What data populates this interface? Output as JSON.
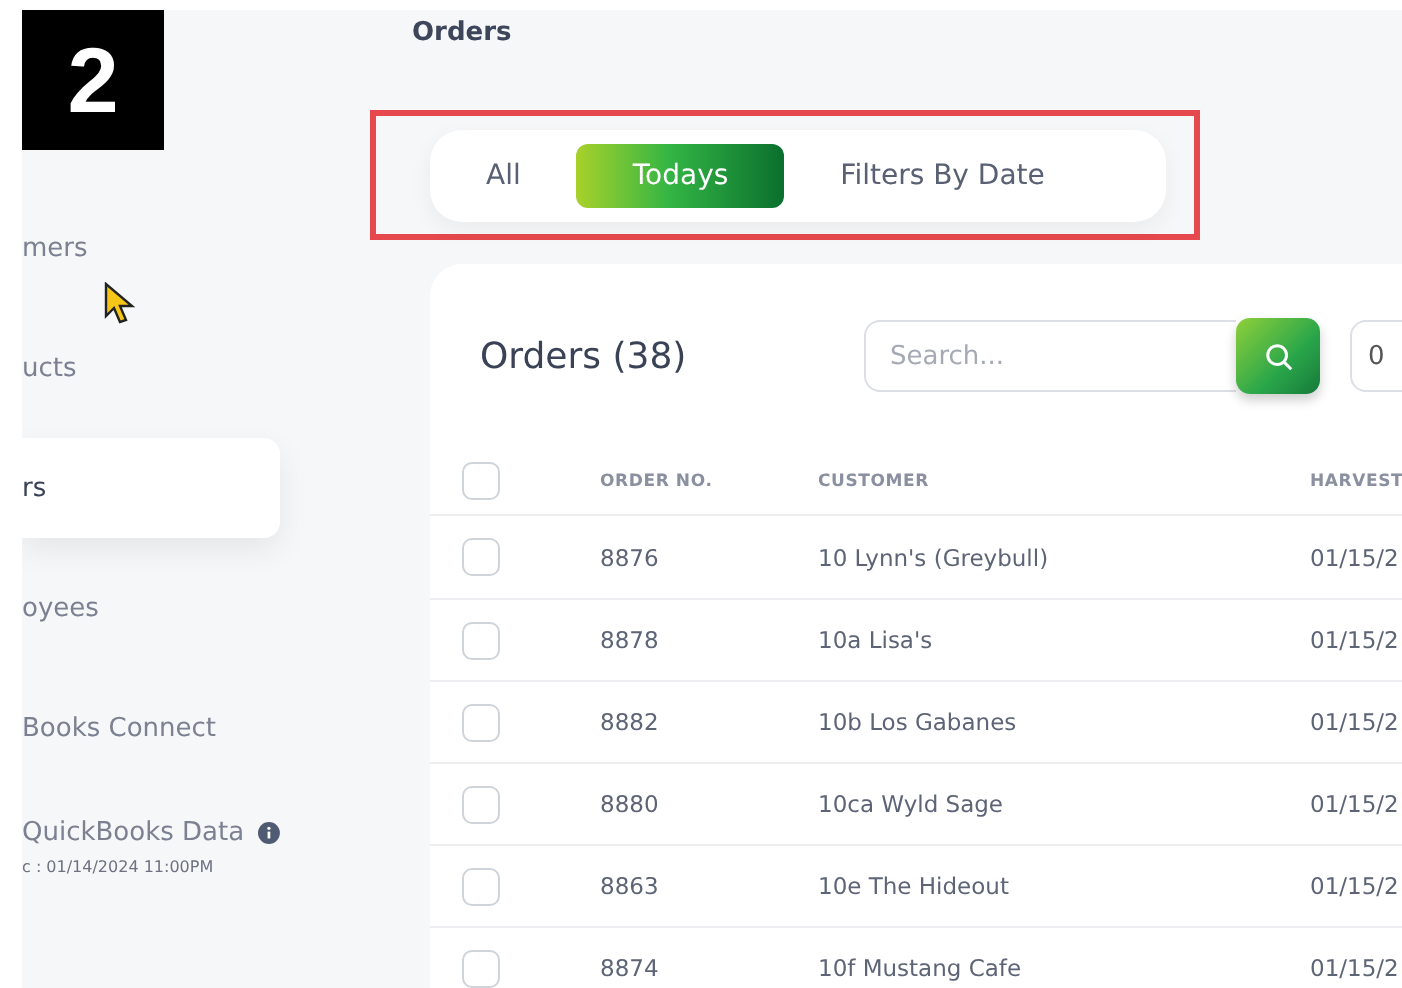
{
  "step_badge": "2",
  "sidebar": {
    "items": [
      {
        "label": "mers",
        "selected": false
      },
      {
        "label": "ucts",
        "selected": false
      },
      {
        "label": "rs",
        "selected": true
      },
      {
        "label": "oyees",
        "selected": false
      },
      {
        "label": "Books Connect",
        "selected": false
      },
      {
        "label": "QuickBooks Data",
        "selected": false,
        "subtitle": "c : 01/14/2024 11:00PM",
        "info": true
      }
    ]
  },
  "page_title": "Orders",
  "filter_tabs": {
    "highlighted": true,
    "tabs": [
      {
        "label": "All",
        "selected": false
      },
      {
        "label": "Todays",
        "selected": true
      },
      {
        "label": "Filters By Date",
        "selected": false
      }
    ]
  },
  "orders_card": {
    "title": "Orders (38)",
    "search": {
      "placeholder": "Search..."
    },
    "field_2": {
      "value": "0"
    },
    "select_all": {
      "checked": false
    },
    "columns": [
      "ORDER NO.",
      "CUSTOMER",
      "HARVEST"
    ],
    "rows": [
      {
        "checked": false,
        "cells": [
          "8876",
          "10 Lynn's (Greybull)",
          "01/15/2"
        ]
      },
      {
        "checked": false,
        "cells": [
          "8878",
          "10a Lisa's",
          "01/15/2"
        ]
      },
      {
        "checked": false,
        "cells": [
          "8882",
          "10b Los Gabanes",
          "01/15/2"
        ]
      },
      {
        "checked": false,
        "cells": [
          "8880",
          "10ca Wyld Sage",
          "01/15/2"
        ]
      },
      {
        "checked": false,
        "cells": [
          "8863",
          "10e The Hideout",
          "01/15/2"
        ]
      },
      {
        "checked": false,
        "cells": [
          "8874",
          "10f Mustang Cafe",
          "01/15/2"
        ]
      }
    ]
  }
}
